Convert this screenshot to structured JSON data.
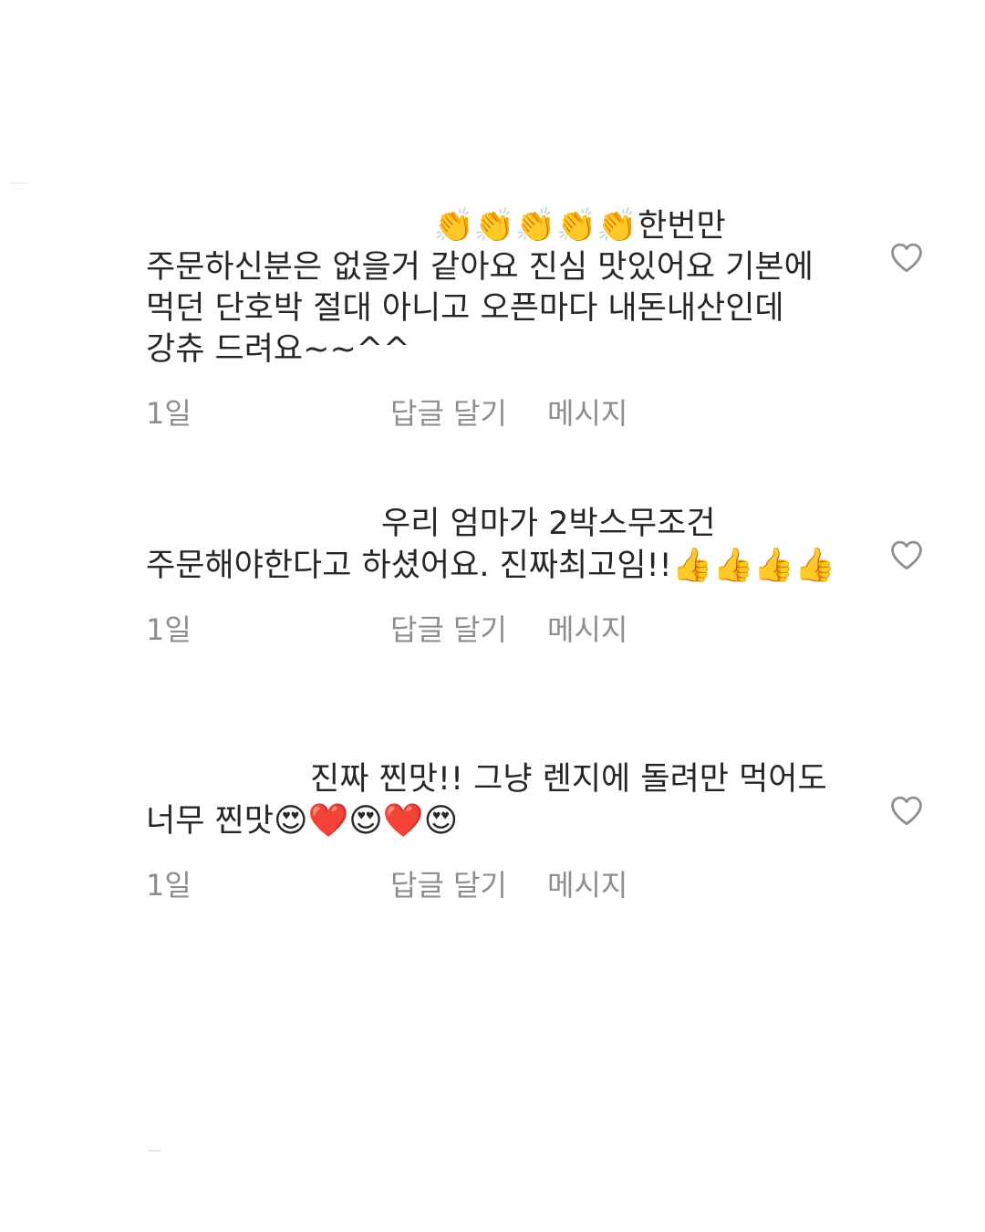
{
  "comments": [
    {
      "lead_emoji": "👏👏👏👏👏",
      "text": "한번만 주문하신분은 없을거 같아요 진심 맛있어요 기본에 먹던 단호박 절대 아니고 오픈마다 내돈내산인데 강츄 드려요~~^^",
      "trail_emoji": "",
      "time": "1일",
      "reply_label": "답글 달기",
      "message_label": "메시지",
      "like_icon": "heart-outline-icon"
    },
    {
      "lead_emoji": "",
      "text": "우리 엄마가 2박스무조건 주문해야한다고 하셨어요. 진짜최고임!!",
      "trail_emoji": "👍👍👍👍",
      "time": "1일",
      "reply_label": "답글 달기",
      "message_label": "메시지",
      "like_icon": "heart-outline-icon"
    },
    {
      "lead_emoji": "",
      "text": "진짜 찐맛!! 그냥 렌지에 돌려만 먹어도 너무 찐맛",
      "trail_emoji": "😍❤️😍❤️😍",
      "time": "1일",
      "reply_label": "답글 달기",
      "message_label": "메시지",
      "like_icon": "heart-outline-icon"
    }
  ],
  "colors": {
    "text": "#262626",
    "meta": "#8e8e8e",
    "heart_stroke": "#8e8e8e",
    "background": "#ffffff"
  }
}
